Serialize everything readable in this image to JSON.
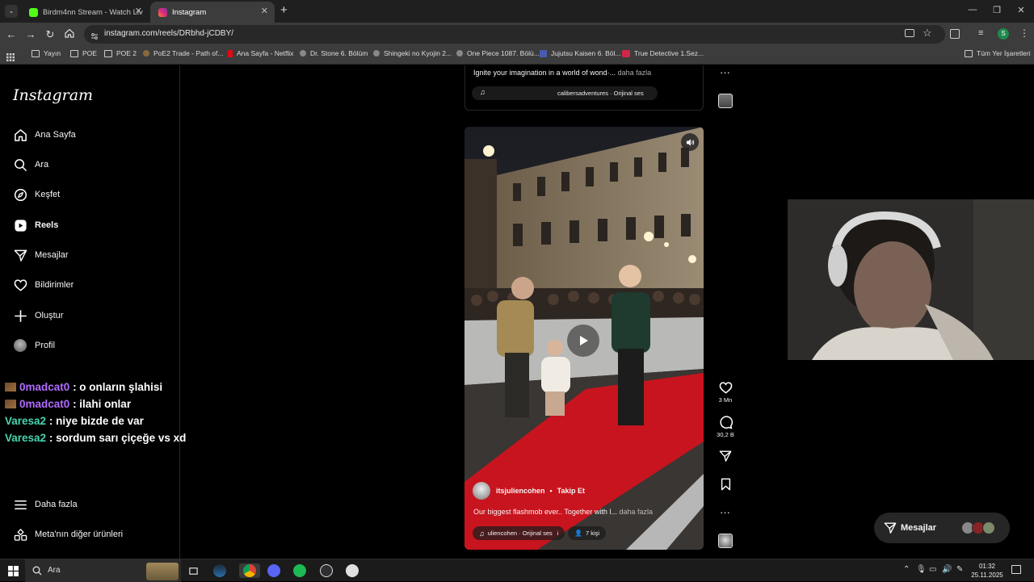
{
  "browser": {
    "tabs": [
      {
        "title": "Birdm4nn Stream - Watch Live o",
        "favicon_color": "#53fc18",
        "active": false
      },
      {
        "title": "Instagram",
        "favicon_color": "#dd2a7b",
        "active": true
      }
    ],
    "url": "instagram.com/reels/DRbhd-jCDBY/",
    "bookmarks": [
      "Yayın",
      "POE",
      "POE 2",
      "PoE2 Trade - Path of...",
      "Ana Sayfa - Netflix",
      "Dr. Stone 6. Bölüm",
      "Shingeki no Kyojin 2...",
      "One Piece 1087. Bölü...",
      "Jujutsu Kaisen 6. Böl...",
      "True Detective 1.Sez..."
    ],
    "all_bookmarks": "Tüm Yer İşaretleri",
    "profile_initial": "S"
  },
  "instagram": {
    "logo": "Instagram",
    "nav": [
      {
        "label": "Ana Sayfa",
        "icon": "home-icon"
      },
      {
        "label": "Ara",
        "icon": "search-icon"
      },
      {
        "label": "Keşfet",
        "icon": "compass-icon"
      },
      {
        "label": "Reels",
        "icon": "reels-icon"
      },
      {
        "label": "Mesajlar",
        "icon": "paper-plane-icon"
      },
      {
        "label": "Bildirimler",
        "icon": "heart-icon"
      },
      {
        "label": "Oluştur",
        "icon": "plus-icon"
      },
      {
        "label": "Profil",
        "icon": "avatar-icon"
      }
    ],
    "more": "Daha fazla",
    "meta_products": "Meta'nın diğer ürünleri",
    "prev_reel": {
      "caption": "Ignite your imagination in a world of wond·",
      "ellipsis": "... ",
      "more": "daha fazla",
      "audio": "calibersadventures · Orijinal ses"
    },
    "reel": {
      "username": "itsjuliencohen",
      "dot": "•",
      "follow": "Takip Et",
      "caption": "Our biggest flashmob ever.. Together with l",
      "ellipsis": "... ",
      "more": "daha fazla",
      "audio": "uliencohen · Orijinal ses",
      "audio_sep": "i",
      "people": "7 kişi",
      "likes": "3 Mn",
      "comments": "30,2 B"
    },
    "messages_label": "Mesajlar"
  },
  "chat": [
    {
      "user": "0madcat0",
      "text": ": o onların şlahisi",
      "color": "#b06cff",
      "badge": true
    },
    {
      "user": "0madcat0",
      "text": ": ilahi onlar",
      "color": "#b06cff",
      "badge": true
    },
    {
      "user": "Varesa2",
      "text": ": niye bizde de var",
      "color": "#47d6b0",
      "badge": false
    },
    {
      "user": "Varesa2",
      "text": ": sordum sarı çiçeğe vs xd",
      "color": "#47d6b0",
      "badge": false
    }
  ],
  "taskbar": {
    "search": "Ara",
    "time": "01:32",
    "date": "25.11.2025"
  }
}
